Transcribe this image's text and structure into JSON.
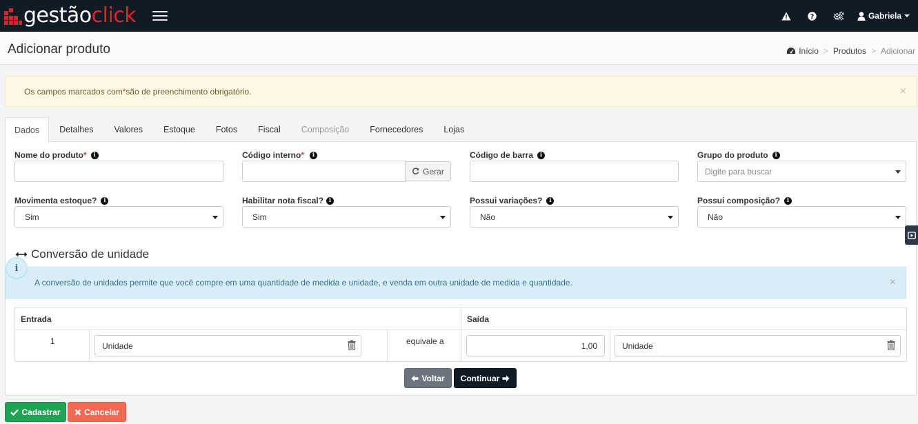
{
  "app": {
    "logo_part1": "gestão",
    "logo_part2": "click",
    "user_name": "Gabriela"
  },
  "header": {
    "title": "Adicionar produto",
    "breadcrumb": [
      "Início",
      "Produtos",
      "Adicionar"
    ]
  },
  "notice": {
    "before": "Os campos marcados com ",
    "star": "*",
    "after": " são de preenchimento obrigatório.",
    "close": "×"
  },
  "tabs": [
    {
      "label": "Dados",
      "state": "active"
    },
    {
      "label": "Detalhes",
      "state": "normal"
    },
    {
      "label": "Valores",
      "state": "normal"
    },
    {
      "label": "Estoque",
      "state": "normal"
    },
    {
      "label": "Fotos",
      "state": "normal"
    },
    {
      "label": "Fiscal",
      "state": "normal"
    },
    {
      "label": "Composição",
      "state": "disabled"
    },
    {
      "label": "Fornecedores",
      "state": "normal"
    },
    {
      "label": "Lojas",
      "state": "normal"
    }
  ],
  "form": {
    "nome": {
      "label": "Nome do produto",
      "required": "*",
      "value": ""
    },
    "codigo": {
      "label": "Código interno",
      "required": "*",
      "value": "",
      "gerar_label": "Gerar"
    },
    "barra": {
      "label": "Código de barra",
      "value": ""
    },
    "grupo": {
      "label": "Grupo do produto",
      "placeholder": "Digite para buscar"
    },
    "movimenta": {
      "label": "Movimenta estoque?",
      "value": "Sim"
    },
    "nota": {
      "label": "Habilitar nota fiscal?",
      "value": "Sim"
    },
    "variacoes": {
      "label": "Possui variações?",
      "value": "Não"
    },
    "composicao": {
      "label": "Possui composição?",
      "value": "Não"
    }
  },
  "conversion": {
    "title": "Conversão de unidade",
    "info_text": "A conversão de unidades permite que você compre em uma quantidade de medida e unidade, e venda em outra unidade de medida e quantidade.",
    "info_close": "×",
    "entrada_header": "Entrada",
    "saida_header": "Saída",
    "entrada_qty": "1",
    "entrada_unit": "Unidade",
    "equivale": "equivale a",
    "saida_qty": "1,00",
    "saida_unit": "Unidade"
  },
  "nav_buttons": {
    "voltar": "Voltar",
    "continuar": "Continuar"
  },
  "footer_buttons": {
    "cadastrar": "Cadastrar",
    "cancelar": "Cancelar"
  },
  "colors": {
    "topbar": "#101b26",
    "brand_red": "#e2232a",
    "success": "#1fa354",
    "danger": "#f56954",
    "secondary": "#6c757d"
  }
}
